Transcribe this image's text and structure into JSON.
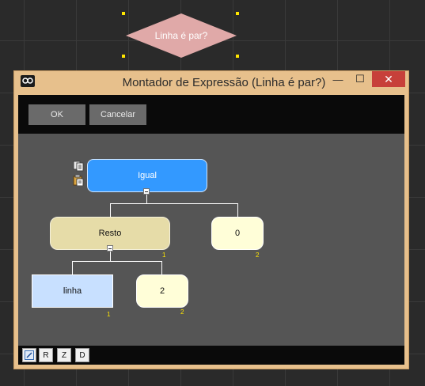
{
  "background": {
    "decision_label": "Linha é par?"
  },
  "window": {
    "title": "Montador de Expressão (Linha é par?)",
    "minimize_glyph": "—",
    "maximize_glyph": "☐",
    "close_glyph": "✕",
    "ok_label": "OK",
    "cancel_label": "Cancelar"
  },
  "tree": {
    "root": {
      "label": "Igual"
    },
    "left": {
      "label": "Resto",
      "index": "1"
    },
    "right": {
      "label": "0",
      "index": "2"
    },
    "left_left": {
      "label": "linha",
      "index": "1"
    },
    "left_right": {
      "label": "2",
      "index": "2"
    }
  },
  "bottom_toolbar": {
    "r_label": "R",
    "z_label": "Z",
    "d_label": "D"
  },
  "colors": {
    "window_frame": "#e7c08c",
    "close_button": "#c7403a",
    "root_node": "#3399ff",
    "operator_node": "#e6dca8",
    "literal_node": "#fffed8",
    "variable_node": "#c8e0ff",
    "index_text": "#ffe600"
  }
}
